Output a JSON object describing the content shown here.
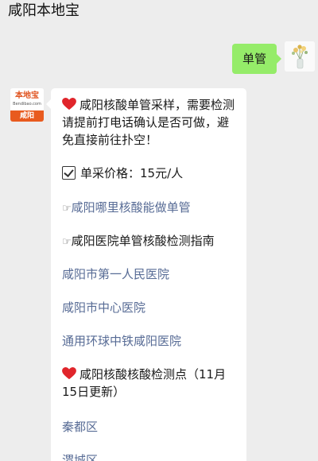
{
  "header": {
    "title": "咸阳本地宝"
  },
  "outgoing": {
    "text": "单管",
    "avatar": "flower-vase-avatar"
  },
  "incoming": {
    "avatar": {
      "brand": "本地宝",
      "site": "Bendibao.com",
      "city": "咸阳"
    },
    "intro": "咸阳核酸单管采样，需要检测请提前打电话确认是否可做，避免直接前往扑空！",
    "price": "单采价格：15元/人",
    "link_where": "咸阳哪里核酸能做单管",
    "link_guide": "咸阳医院单管核酸检测指南",
    "hospital_1": "咸阳市第一人民医院",
    "hospital_2": "咸阳市中心医院",
    "hospital_3": "通用环球中铁咸阳医院",
    "points_title": "咸阳核酸核酸检测点（11月15日更新）",
    "district_1": "秦都区",
    "district_2": "渭城区"
  },
  "colors": {
    "bubble_out": "#95ec69",
    "link": "#576b95",
    "heart": "#e0252b",
    "background": "#ededed"
  },
  "icons": {
    "heart": "heart-icon",
    "check": "checkbox-icon",
    "pointing_hand": "pointing-hand-icon"
  }
}
